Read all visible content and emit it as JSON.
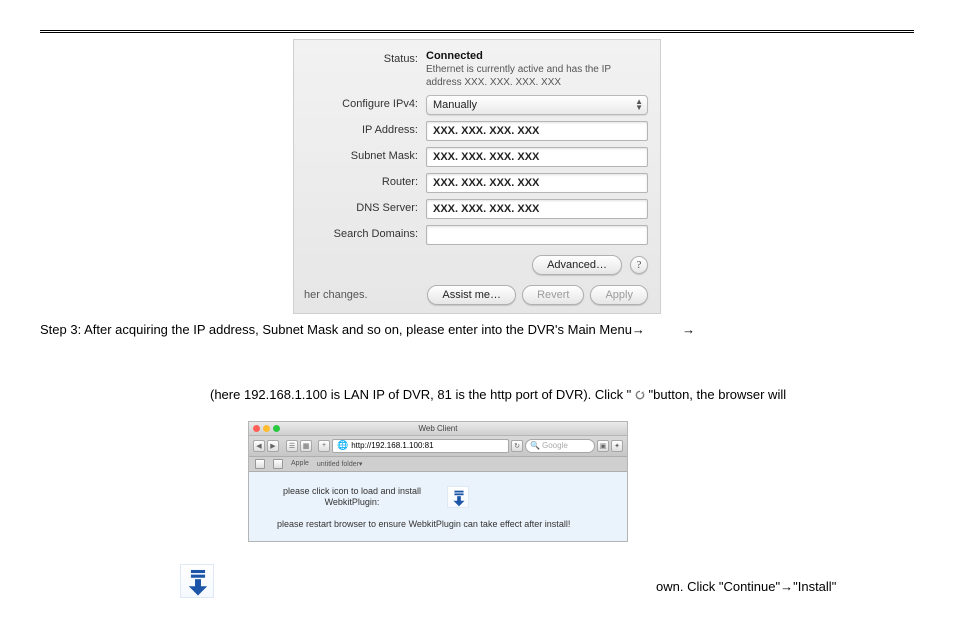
{
  "network_panel": {
    "labels": {
      "status": "Status:",
      "configure": "Configure IPv4:",
      "ip": "IP Address:",
      "subnet": "Subnet Mask:",
      "router": "Router:",
      "dns": "DNS Server:",
      "search": "Search Domains:"
    },
    "status_value": "Connected",
    "status_desc": "Ethernet is currently active and has the IP address XXX. XXX. XXX. XXX",
    "configure_value": "Manually",
    "ip_value": "XXX. XXX. XXX. XXX",
    "subnet_value": "XXX. XXX. XXX. XXX",
    "router_value": "XXX. XXX. XXX. XXX",
    "dns_value": "XXX. XXX. XXX. XXX",
    "search_value": "",
    "buttons": {
      "advanced": "Advanced…",
      "help": "?",
      "assist": "Assist me…",
      "revert": "Revert",
      "apply": "Apply"
    },
    "footer_left": "her changes."
  },
  "text": {
    "step3_line1_a": "Step 3: After acquiring the IP address, Subnet Mask and so on, please enter into the DVR's Main Menu",
    "arrow": "→",
    "line2_a": "(here 192.168.1.100 is LAN IP of DVR, 81 is the http port of DVR). Click \" ",
    "line2_b": " \"button, the browser will",
    "line3": "own. Click \"Continue\"→\"Install\""
  },
  "browser": {
    "title": "Web Client",
    "url": "http://192.168.1.100:81",
    "search_placeholder": "Google",
    "bookmarks": {
      "apple": "Apple",
      "untitled": "untitled folder▾"
    },
    "plug_text": "please click icon to load and install WebkitPlugin:",
    "restart_text": "please restart browser to ensure WebkitPlugin can take effect after install!"
  }
}
